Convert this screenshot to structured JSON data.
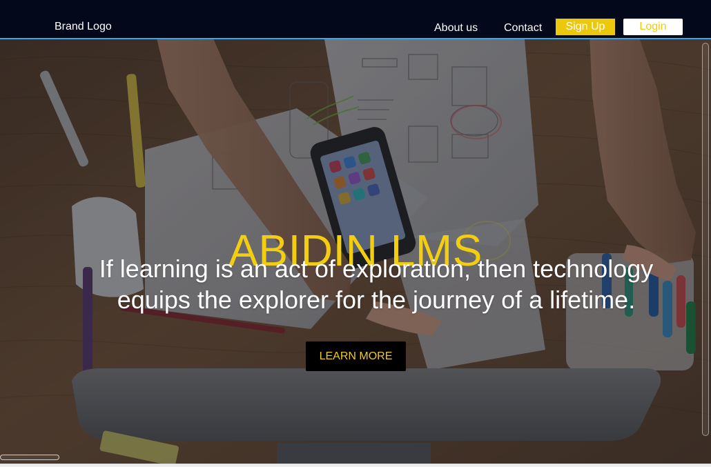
{
  "header": {
    "brand": "Brand Logo",
    "nav": {
      "about": "About us",
      "contact": "Contact",
      "signup": "Sign Up",
      "login": "Login"
    }
  },
  "hero": {
    "title": "ABIDIN LMS",
    "tagline_line1": "If learning is an act of exploration, then technology",
    "tagline_line2": "equips the explorer for the journey of a lifetime.",
    "cta": "LEARN MORE"
  },
  "colors": {
    "header_bg": "#03091b",
    "accent_yellow": "#f2cd12",
    "signup_bg": "#ecc80c",
    "header_border": "#3ea7e8",
    "hero_overlay": "#080810"
  }
}
